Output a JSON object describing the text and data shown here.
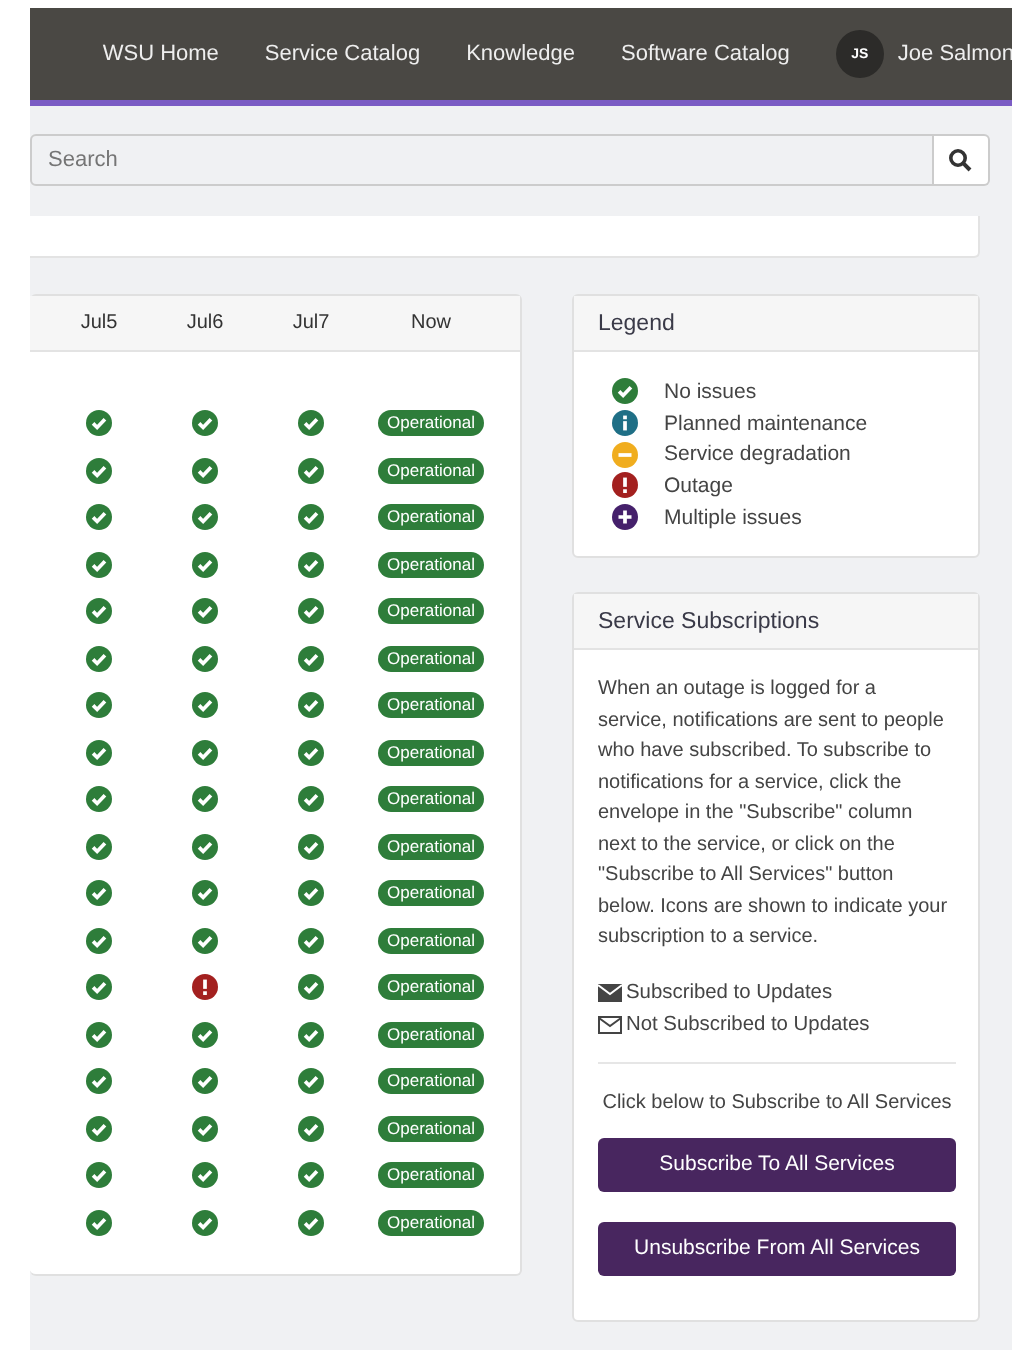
{
  "nav": {
    "links": [
      "WSU Home",
      "Service Catalog",
      "Knowledge",
      "Software Catalog"
    ],
    "user": {
      "initials": "JS",
      "name": "Joe Salmon"
    }
  },
  "search": {
    "placeholder": "Search"
  },
  "status_table": {
    "columns": [
      "Jul5",
      "Jul6",
      "Jul7",
      "Now"
    ],
    "rows": [
      {
        "days": [
          {
            "kind": "ok"
          },
          {
            "kind": "ok"
          },
          {
            "kind": "ok"
          }
        ],
        "now": "Operational"
      },
      {
        "days": [
          {
            "kind": "ok"
          },
          {
            "kind": "ok"
          },
          {
            "kind": "ok"
          }
        ],
        "now": "Operational"
      },
      {
        "days": [
          {
            "kind": "ok"
          },
          {
            "kind": "ok"
          },
          {
            "kind": "ok"
          }
        ],
        "now": "Operational"
      },
      {
        "days": [
          {
            "kind": "ok"
          },
          {
            "kind": "ok"
          },
          {
            "kind": "ok"
          }
        ],
        "now": "Operational"
      },
      {
        "days": [
          {
            "kind": "ok"
          },
          {
            "kind": "ok"
          },
          {
            "kind": "ok"
          }
        ],
        "now": "Operational"
      },
      {
        "days": [
          {
            "kind": "ok"
          },
          {
            "kind": "ok"
          },
          {
            "kind": "ok"
          }
        ],
        "now": "Operational"
      },
      {
        "days": [
          {
            "kind": "ok"
          },
          {
            "kind": "ok"
          },
          {
            "kind": "ok"
          }
        ],
        "now": "Operational"
      },
      {
        "days": [
          {
            "kind": "ok"
          },
          {
            "kind": "ok"
          },
          {
            "kind": "ok"
          }
        ],
        "now": "Operational"
      },
      {
        "days": [
          {
            "kind": "ok"
          },
          {
            "kind": "ok"
          },
          {
            "kind": "ok"
          }
        ],
        "now": "Operational"
      },
      {
        "days": [
          {
            "kind": "ok"
          },
          {
            "kind": "ok"
          },
          {
            "kind": "ok"
          }
        ],
        "now": "Operational"
      },
      {
        "days": [
          {
            "kind": "ok"
          },
          {
            "kind": "ok"
          },
          {
            "kind": "ok"
          }
        ],
        "now": "Operational"
      },
      {
        "days": [
          {
            "kind": "ok"
          },
          {
            "kind": "ok"
          },
          {
            "kind": "ok"
          }
        ],
        "now": "Operational"
      },
      {
        "days": [
          {
            "kind": "ok"
          },
          {
            "kind": "outage"
          },
          {
            "kind": "ok"
          }
        ],
        "now": "Operational"
      },
      {
        "days": [
          {
            "kind": "ok"
          },
          {
            "kind": "ok"
          },
          {
            "kind": "ok"
          }
        ],
        "now": "Operational"
      },
      {
        "days": [
          {
            "kind": "ok"
          },
          {
            "kind": "ok"
          },
          {
            "kind": "ok"
          }
        ],
        "now": "Operational"
      },
      {
        "days": [
          {
            "kind": "ok"
          },
          {
            "kind": "ok"
          },
          {
            "kind": "ok"
          }
        ],
        "now": "Operational"
      },
      {
        "days": [
          {
            "kind": "ok"
          },
          {
            "kind": "ok"
          },
          {
            "kind": "ok"
          }
        ],
        "now": "Operational"
      },
      {
        "days": [
          {
            "kind": "ok"
          },
          {
            "kind": "ok"
          },
          {
            "kind": "ok"
          }
        ],
        "now": "Operational"
      }
    ]
  },
  "legend": {
    "title": "Legend",
    "items": [
      {
        "kind": "ok",
        "label": "No issues"
      },
      {
        "kind": "maintenance",
        "label": "Planned maintenance"
      },
      {
        "kind": "degradation",
        "label": "Service degradation"
      },
      {
        "kind": "outage",
        "label": "Outage"
      },
      {
        "kind": "multiple",
        "label": "Multiple issues"
      }
    ]
  },
  "subscriptions": {
    "title": "Service Subscriptions",
    "text": "When an outage is logged for a service, notifications are sent to people who have subscribed. To subscribe to notifications for a service, click the envelope in the \"Subscribe\" column next to the service, or click on the \"Subscribe to All Services\" button below. Icons are shown to indicate your subscription to a service.",
    "keys": [
      {
        "kind": "subscribed",
        "label": "Subscribed to Updates"
      },
      {
        "kind": "unsubscribed",
        "label": "Not Subscribed to Updates"
      }
    ],
    "prompt": "Click below to Subscribe to All Services",
    "buttons": [
      "Subscribe To All Services",
      "Unsubscribe From All Services"
    ]
  }
}
